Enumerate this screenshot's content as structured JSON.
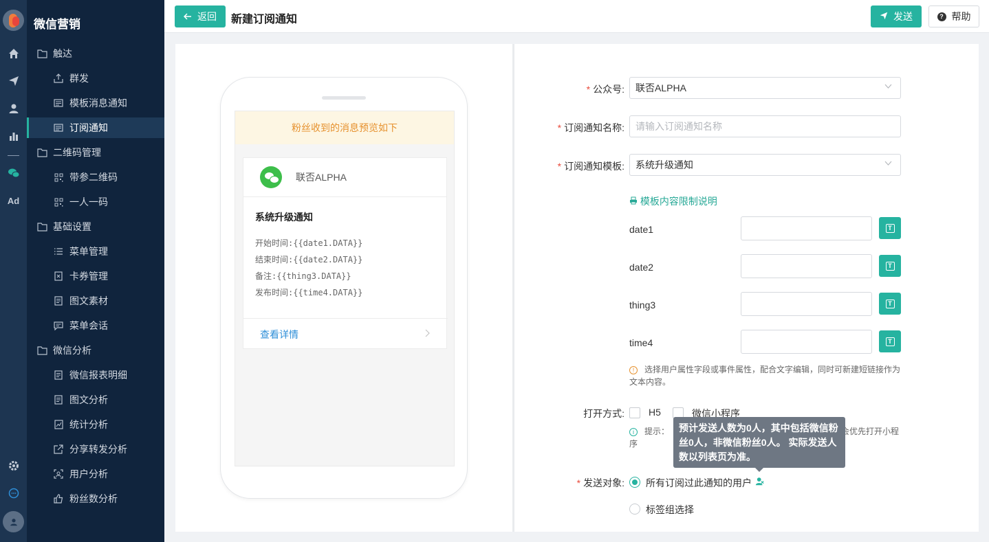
{
  "app": {
    "name": "微信营销"
  },
  "rail": {
    "icons": [
      "logo-icon",
      "home-icon",
      "send-icon",
      "user-icon",
      "chart-icon",
      "wechat-icon",
      "ad-icon",
      "gear-icon",
      "chat-icon",
      "avatar"
    ],
    "ad_label": "Ad"
  },
  "sidebar": {
    "items": [
      {
        "label": "触达",
        "type": "group",
        "icon": "folder-icon"
      },
      {
        "label": "群发",
        "type": "sub",
        "icon": "upload-icon"
      },
      {
        "label": "模板消息通知",
        "type": "sub",
        "icon": "template-icon"
      },
      {
        "label": "订阅通知",
        "type": "sub",
        "icon": "template-icon",
        "active": true
      },
      {
        "label": "二维码管理",
        "type": "group",
        "icon": "folder-icon"
      },
      {
        "label": "带参二维码",
        "type": "sub",
        "icon": "qrcode-icon"
      },
      {
        "label": "一人一码",
        "type": "sub",
        "icon": "qrcode-icon"
      },
      {
        "label": "基础设置",
        "type": "group",
        "icon": "folder-icon"
      },
      {
        "label": "菜单管理",
        "type": "sub",
        "icon": "list-icon"
      },
      {
        "label": "卡券管理",
        "type": "sub",
        "icon": "coupon-icon"
      },
      {
        "label": "图文素材",
        "type": "sub",
        "icon": "document-icon"
      },
      {
        "label": "菜单会话",
        "type": "sub",
        "icon": "message-icon"
      },
      {
        "label": "微信分析",
        "type": "group",
        "icon": "folder-icon"
      },
      {
        "label": "微信报表明细",
        "type": "sub",
        "icon": "document-icon"
      },
      {
        "label": "图文分析",
        "type": "sub",
        "icon": "document-icon"
      },
      {
        "label": "统计分析",
        "type": "sub",
        "icon": "stats-icon"
      },
      {
        "label": "分享转发分析",
        "type": "sub",
        "icon": "share-icon"
      },
      {
        "label": "用户分析",
        "type": "sub",
        "icon": "user-scan-icon"
      },
      {
        "label": "粉丝数分析",
        "type": "sub",
        "icon": "thumb-icon"
      }
    ]
  },
  "header": {
    "back_label": "返回",
    "title": "新建订阅通知",
    "send_label": "发送",
    "help_label": "帮助"
  },
  "preview": {
    "notice": "粉丝收到的消息预览如下",
    "account": "联否ALPHA",
    "title": "系统升级通知",
    "lines": [
      "开始时间:{{date1.DATA}}",
      "结束时间:{{date2.DATA}}",
      "备注:{{thing3.DATA}}",
      "发布时间:{{time4.DATA}}"
    ],
    "detail_link": "查看详情"
  },
  "form": {
    "account_label": "公众号:",
    "account_value": "联否ALPHA",
    "name_label": "订阅通知名称:",
    "name_placeholder": "请输入订阅通知名称",
    "template_label": "订阅通知模板:",
    "template_value": "系统升级通知",
    "rule_link": "模板内容限制说明",
    "vars": [
      "date1",
      "date2",
      "thing3",
      "time4"
    ],
    "var_hint": "选择用户属性字段或事件属性，配合文字编辑，同时可新建短链接作为文本内容。",
    "open_label": "打开方式:",
    "open_options": [
      "H5",
      "微信小程序"
    ],
    "open_hint_prefix": "提示：",
    "open_hint_suffix": "会优先打开小程序",
    "target_label": "发送对象:",
    "target_options": [
      "所有订阅过此通知的用户",
      "标签组选择"
    ],
    "tooltip": "预计发送人数为0人，其中包括微信粉丝0人，非微信粉丝0人。 实际发送人数以列表页为准。"
  },
  "colors": {
    "accent": "#26b3a0",
    "sidebar_bg": "#10243d",
    "rail_bg": "#1d3551",
    "required": "#e94b3c",
    "notice_bg": "#fdf6e3",
    "notice_text": "#e6912e",
    "link": "#2f8fd8"
  }
}
